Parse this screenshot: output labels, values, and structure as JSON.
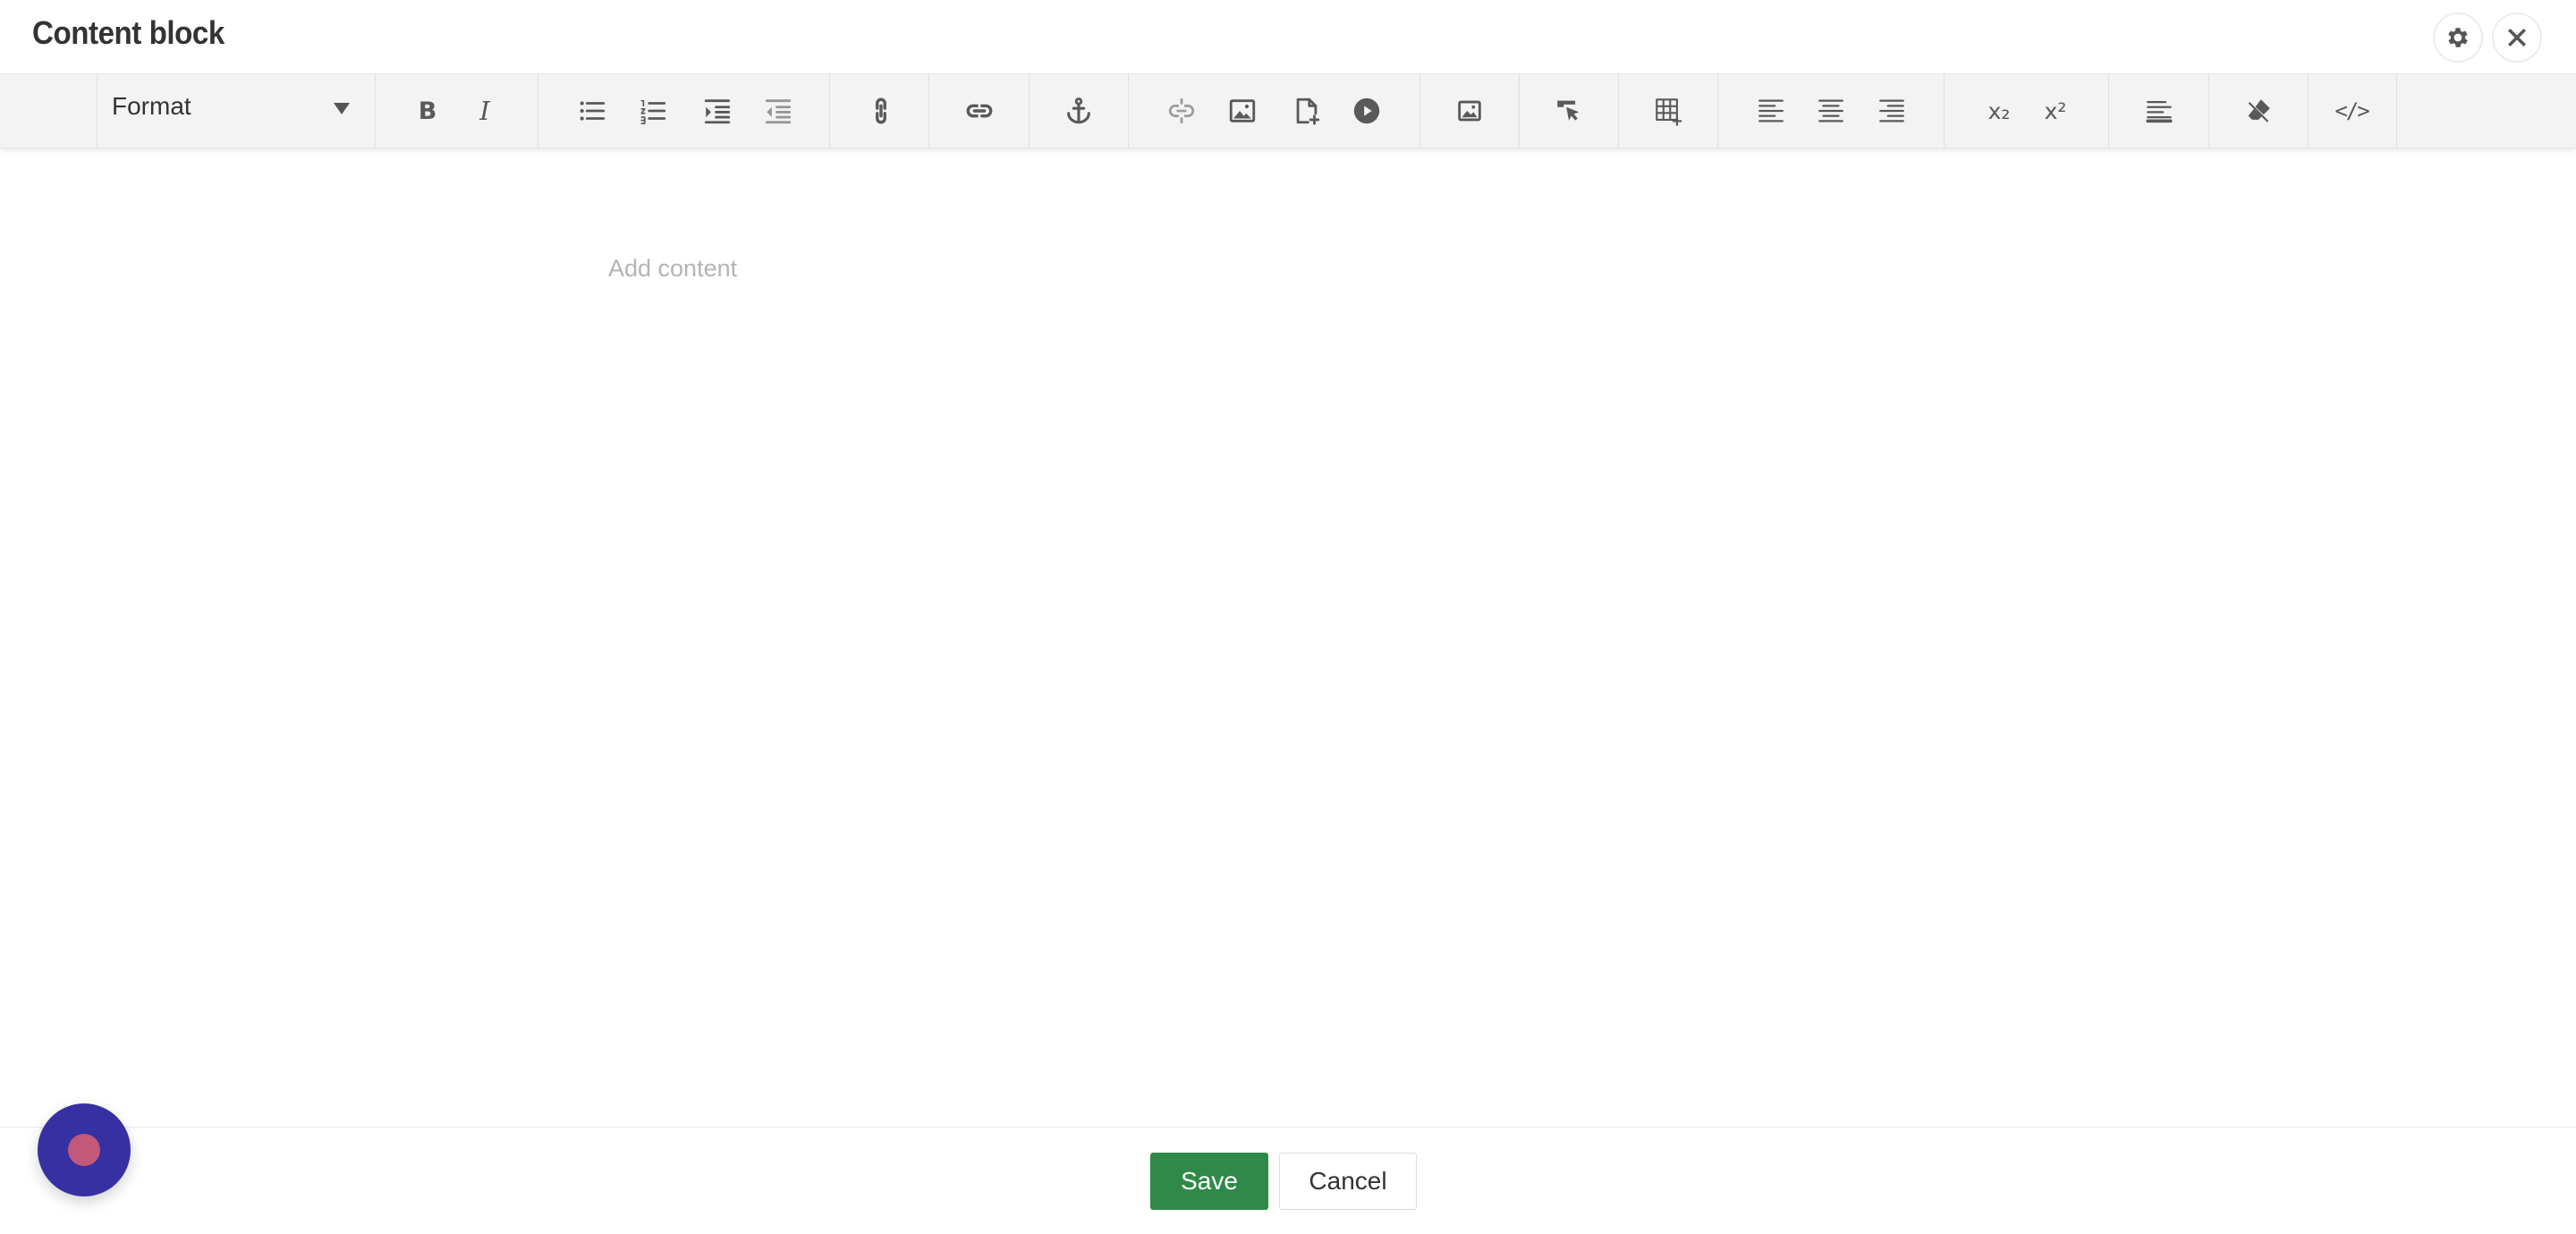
{
  "header": {
    "title": "Content block",
    "settings_icon": "gear-icon",
    "close_icon": "close-icon"
  },
  "toolbar": {
    "format_label": "Format",
    "buttons": [
      {
        "name": "bold",
        "icon": "bold-icon",
        "glyph": "B"
      },
      {
        "name": "italic",
        "icon": "italic-icon",
        "glyph": "I"
      },
      {
        "name": "bulleted-list",
        "icon": "bulleted-list-icon"
      },
      {
        "name": "numbered-list",
        "icon": "numbered-list-icon"
      },
      {
        "name": "indent",
        "icon": "indent-icon"
      },
      {
        "name": "outdent",
        "icon": "outdent-icon"
      },
      {
        "name": "link",
        "icon": "link-vertical-icon"
      },
      {
        "name": "insert-link",
        "icon": "link-icon"
      },
      {
        "name": "anchor",
        "icon": "anchor-icon"
      },
      {
        "name": "unlink",
        "icon": "unlink-icon"
      },
      {
        "name": "image",
        "icon": "image-icon"
      },
      {
        "name": "insert-file",
        "icon": "file-add-icon"
      },
      {
        "name": "media",
        "icon": "play-icon"
      },
      {
        "name": "image-library",
        "icon": "image-icon"
      },
      {
        "name": "pointer",
        "icon": "cursor-icon"
      },
      {
        "name": "table",
        "icon": "table-icon"
      },
      {
        "name": "align-left",
        "icon": "align-left-icon"
      },
      {
        "name": "align-center",
        "icon": "align-center-icon"
      },
      {
        "name": "align-right",
        "icon": "align-right-icon"
      },
      {
        "name": "subscript",
        "icon": "subscript-icon",
        "glyph": "x₂"
      },
      {
        "name": "superscript",
        "icon": "superscript-icon",
        "glyph": "x²"
      },
      {
        "name": "paragraph",
        "icon": "paragraph-align-icon"
      },
      {
        "name": "clear-formatting",
        "icon": "eraser-icon"
      },
      {
        "name": "source-code",
        "icon": "code-icon",
        "glyph": "</>"
      }
    ]
  },
  "editor": {
    "placeholder": "Add content"
  },
  "footer": {
    "save_label": "Save",
    "cancel_label": "Cancel"
  },
  "colors": {
    "save": "#2f8a4a",
    "fab": "#3730a3",
    "fab_dot": "#c2587a"
  }
}
